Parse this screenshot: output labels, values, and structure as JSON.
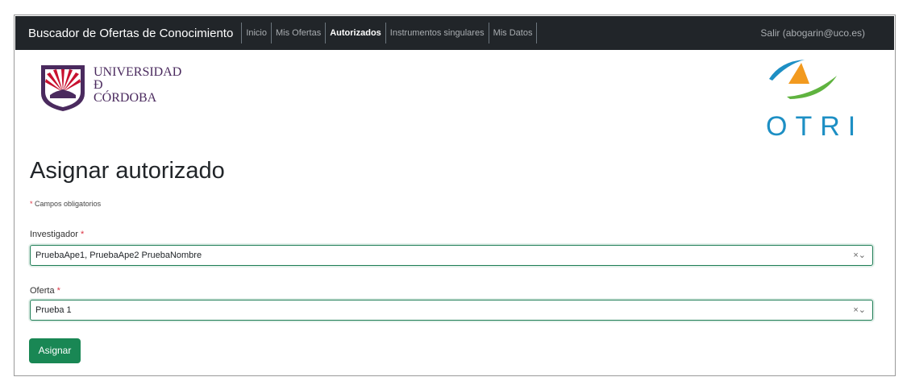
{
  "navbar": {
    "brand": "Buscador de Ofertas de Conocimiento",
    "items": [
      {
        "label": "Inicio",
        "active": false
      },
      {
        "label": "Mis Ofertas",
        "active": false
      },
      {
        "label": "Autorizados",
        "active": true
      },
      {
        "label": "Instrumentos singulares",
        "active": false
      },
      {
        "label": "Mis Datos",
        "active": false
      }
    ],
    "logout": "Salir (abogarin@uco.es)"
  },
  "logos": {
    "uco": {
      "line1": "UNIVERSIDAD",
      "line2": "Đ",
      "line3": "CÓRDOBA"
    },
    "otri": {
      "text": "OTRI"
    }
  },
  "page": {
    "title": "Asignar autorizado",
    "required_star": "*",
    "required_note": "Campos obligatorios"
  },
  "form": {
    "investigador": {
      "label": "Investigador",
      "value": "PruebaApe1, PruebaApe2 PruebaNombre"
    },
    "oferta": {
      "label": "Oferta",
      "value": "Prueba 1"
    },
    "submit_label": "Asignar"
  },
  "icons": {
    "clear": "×",
    "chevron": "⌄"
  },
  "colors": {
    "navbar": "#212529",
    "primary": "#198754",
    "otri_blue": "#1d8fc4",
    "otri_green": "#5fb33f",
    "otri_orange": "#f29a1f",
    "uco_purple": "#4a2a5e",
    "uco_red": "#c8102e"
  }
}
